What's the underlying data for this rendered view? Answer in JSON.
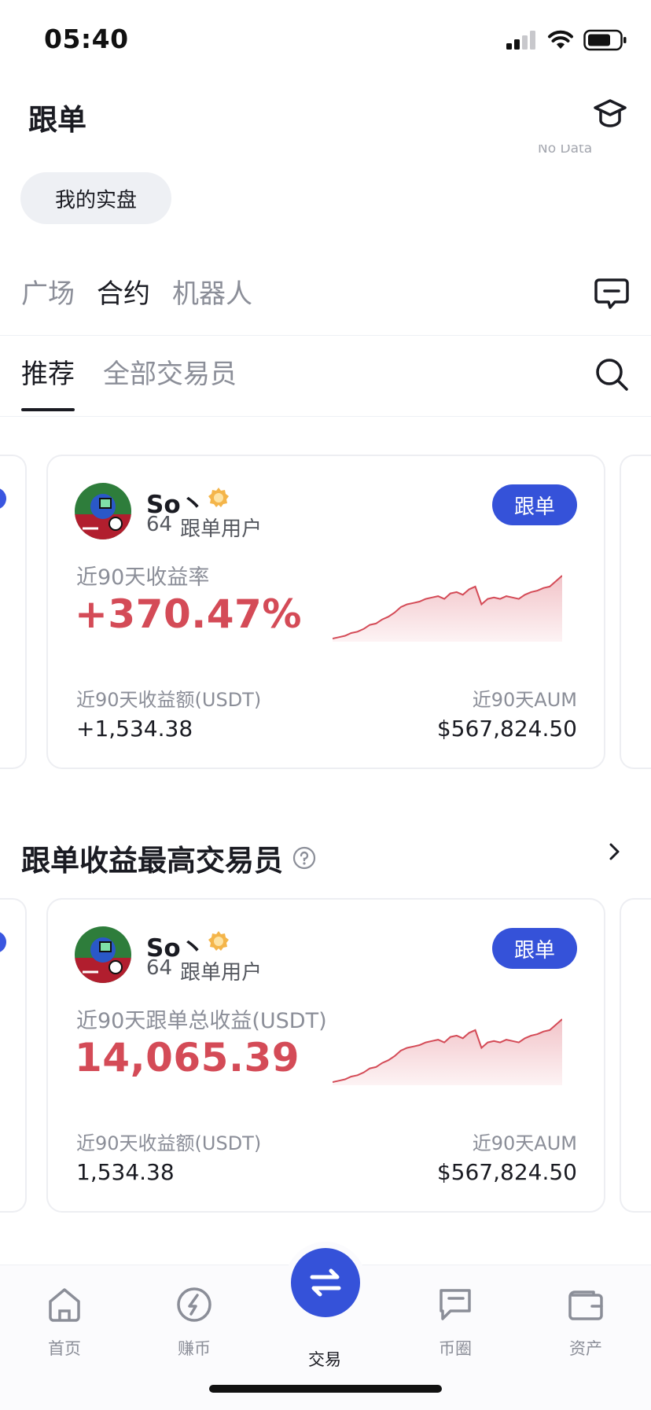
{
  "status": {
    "time": "05:40"
  },
  "header": {
    "title": "跟单",
    "faint_text": "No Data"
  },
  "my_real_button": "我的实盘",
  "top_tabs": [
    {
      "label": "广场",
      "active": false
    },
    {
      "label": "合约",
      "active": true
    },
    {
      "label": "机器人",
      "active": false
    }
  ],
  "sub_tabs": [
    {
      "label": "推荐",
      "active": true
    },
    {
      "label": "全部交易员",
      "active": false
    }
  ],
  "card_1": {
    "trader_name": "So丶",
    "followers_count": "64",
    "followers_label": "跟单用户",
    "follow_button": "跟单",
    "metric_label": "近90天收益率",
    "metric_value": "+370.47%",
    "left_label": "近90天收益额(USDT)",
    "left_value": "+1,534.38",
    "right_label": "近90天AUM",
    "right_value": "$567,824.50"
  },
  "section": {
    "title": "跟单收益最高交易员"
  },
  "card_2": {
    "trader_name": "So丶",
    "followers_count": "64",
    "followers_label": "跟单用户",
    "follow_button": "跟单",
    "metric_label": "近90天跟单总收益(USDT)",
    "metric_value": "14,065.39",
    "left_label": "近90天收益额(USDT)",
    "left_value": "1,534.38",
    "right_label": "近90天AUM",
    "right_value": "$567,824.50"
  },
  "sparkline": [
    2,
    3,
    4,
    6,
    7,
    9,
    12,
    13,
    16,
    18,
    21,
    25,
    27,
    28,
    29,
    31,
    32,
    33,
    31,
    35,
    36,
    34,
    38,
    40,
    27,
    31,
    32,
    31,
    33,
    32,
    31,
    34,
    36,
    37,
    39,
    40,
    44,
    48
  ],
  "bottom_nav": [
    {
      "label": "首页",
      "icon": "home-icon"
    },
    {
      "label": "赚币",
      "icon": "earn-icon"
    },
    {
      "label": "交易",
      "icon": "trade-icon",
      "active": true
    },
    {
      "label": "币圈",
      "icon": "community-icon"
    },
    {
      "label": "资产",
      "icon": "wallet-icon"
    }
  ],
  "colors": {
    "accent": "#3552d9",
    "profit": "#d44b57",
    "chart_fill": "#f6dadd"
  }
}
